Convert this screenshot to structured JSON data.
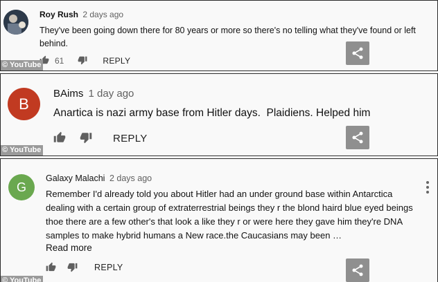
{
  "watermark": "© YouTube",
  "comments": [
    {
      "author": "Roy Rush",
      "time": "2 days ago",
      "text": "They've been going down there for 80 years or more so there's no telling what they've found or left behind.",
      "likes": "61",
      "reply_label": "REPLY"
    },
    {
      "author": "BAims",
      "time": "1 day ago",
      "avatar_letter": "B",
      "avatar_color": "#c13a21",
      "text": "Anartica is nazi army base from Hitler days.  Plaidiens. Helped him",
      "reply_label": "REPLY"
    },
    {
      "author": "Galaxy Malachi",
      "time": "2 days ago",
      "avatar_letter": "G",
      "avatar_color": "#6aa84f",
      "text": "Remember I'd already told you about Hitler had an under ground base within Antarctica dealing with a certain group of extraterrestrial beings they r the blond haird blue eyed beings thoe there are a few other's that look a like they r or were here they gave him they're DNA samples to make hybrid humans a New race.the Caucasians may been …",
      "read_more": "Read more",
      "reply_label": "REPLY"
    }
  ],
  "icons": {
    "like": "thumbs-up-icon",
    "dislike": "thumbs-down-icon",
    "share": "share-icon",
    "menu": "more-vert-icon"
  }
}
